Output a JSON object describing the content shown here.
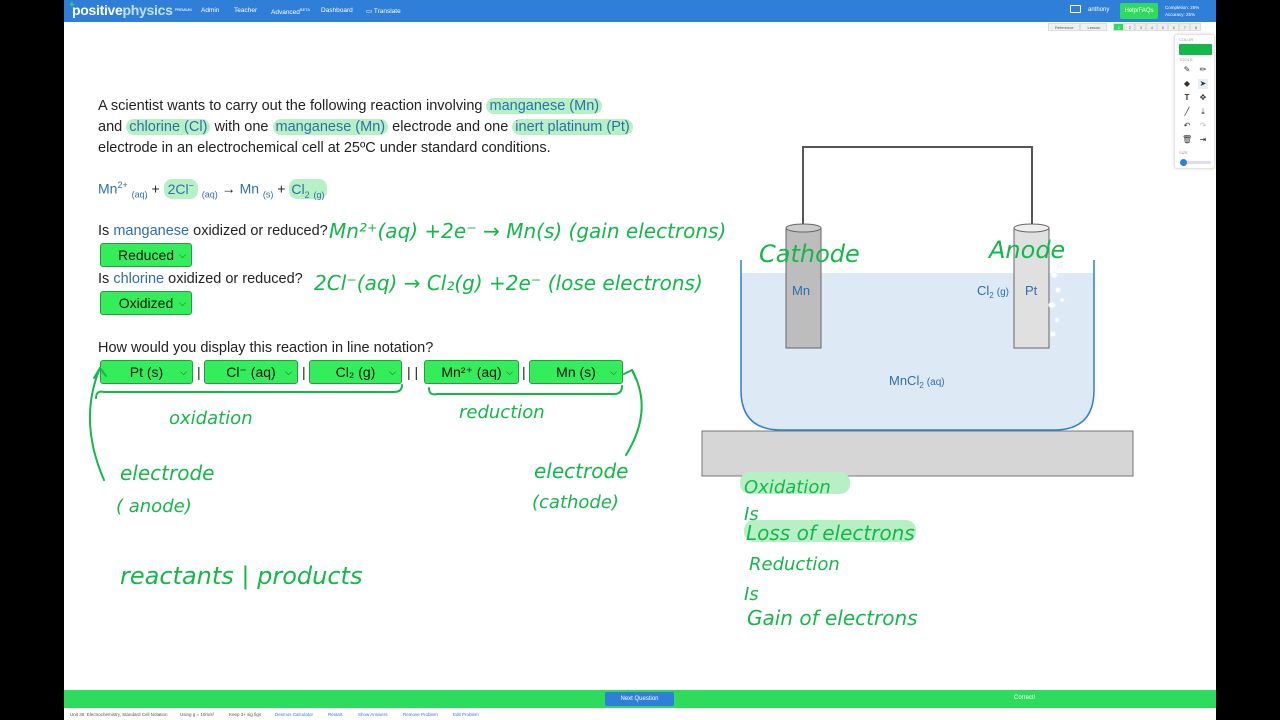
{
  "brand": {
    "name_a": "positive",
    "name_b": "physics",
    "badge": "PREMIUM"
  },
  "nav": {
    "admin": "Admin",
    "teacher": "Teacher",
    "advanced": "Advanced",
    "advanced_sup": "BETA",
    "dashboard": "Dashboard",
    "translate": "Translate"
  },
  "user": {
    "name": "anthony",
    "help": "Help/FAQs",
    "completion": "Completion: 25%",
    "accuracy": "Accuracy: 25%"
  },
  "subnav": {
    "reference": "Reference",
    "lesson": "Lesson",
    "pages": [
      "1",
      "2",
      "3",
      "4",
      "5",
      "6",
      "7",
      "8"
    ]
  },
  "tools": {
    "color_label": "COLOR",
    "tools_label": "TOOLS",
    "size_label": "SIZE",
    "color": "#14b84a"
  },
  "problem": {
    "intro_1": "A scientist wants to carry out the following reaction involving",
    "mn_word": "manganese",
    "mn_sym": "Mn",
    "and": "and",
    "cl_word": "chlorine",
    "cl_sym": "Cl",
    "with_one": "with one",
    "electrode_and_one": "electrode and one",
    "pt_word": "inert platinum",
    "pt_sym": "Pt",
    "intro_3": "electrode in an electrochemical cell at 25ºC under standard conditions."
  },
  "equation": {
    "mn2": "Mn",
    "mn2_sup": "2+",
    "aq": "(aq)",
    "plus": "+",
    "cl": "2Cl",
    "cl_sup": "−",
    "arrow": "→",
    "mn": "Mn",
    "s": "(s)",
    "cl2": "Cl",
    "cl2_sub": "2",
    "g": "(g)"
  },
  "q1": {
    "prefix": "Is",
    "word": "manganese",
    "suffix": "oxidized or reduced?",
    "answer": "Reduced"
  },
  "q2": {
    "prefix": "Is",
    "word": "chlorine",
    "suffix": "oxidized or reduced?",
    "answer": "Oxidized"
  },
  "q3": {
    "text": "How would you display this reaction in line notation?",
    "slots": [
      "Pt (s)",
      "Cl⁻ (aq)",
      "Cl₂ (g)",
      "Mn²⁺ (aq)",
      "Mn (s)"
    ],
    "sep1": "|",
    "sep2": "|",
    "sep3": "| |",
    "sep4": "|"
  },
  "diagram": {
    "mn": "Mn",
    "pt": "Pt",
    "cl2": "Cl",
    "cl2_sub": "2",
    "cl2_state": "(g)",
    "mncl2": "MnCl",
    "mncl2_sub": "2",
    "mncl2_state": "(aq)"
  },
  "ink": {
    "half1": "Mn²⁺(aq) +2e⁻ → Mn(s) (gain electrons)",
    "half2": "2Cl⁻(aq) → Cl₂(g) +2e⁻ (lose electrons)",
    "cathode": "Cathode",
    "anode": "Anode",
    "oxidation": "oxidation",
    "reduction": "reduction",
    "electrode_a": "electrode",
    "anode_p": "( anode)",
    "electrode_c": "electrode",
    "cathode_p": "(cathode)",
    "reactants": "reactants | products",
    "oil": [
      "Oxidation",
      "Is",
      "Loss of electrons"
    ],
    "rig": [
      "Reduction",
      "Is",
      "Gain of electrons"
    ]
  },
  "bottom": {
    "next": "Next Question",
    "correct": "Correct!"
  },
  "footer": {
    "unit": "Unit 30: Electrochemistry, Standard Cell Notation",
    "g": "Using g = 10m/s²",
    "sigfigs": "Keep 3+ sig figs",
    "desmos": "Desmos Calculator",
    "restart": "Restart",
    "show": "Show Answers",
    "remove": "Remove Problem",
    "edit": "Edit Problem"
  }
}
